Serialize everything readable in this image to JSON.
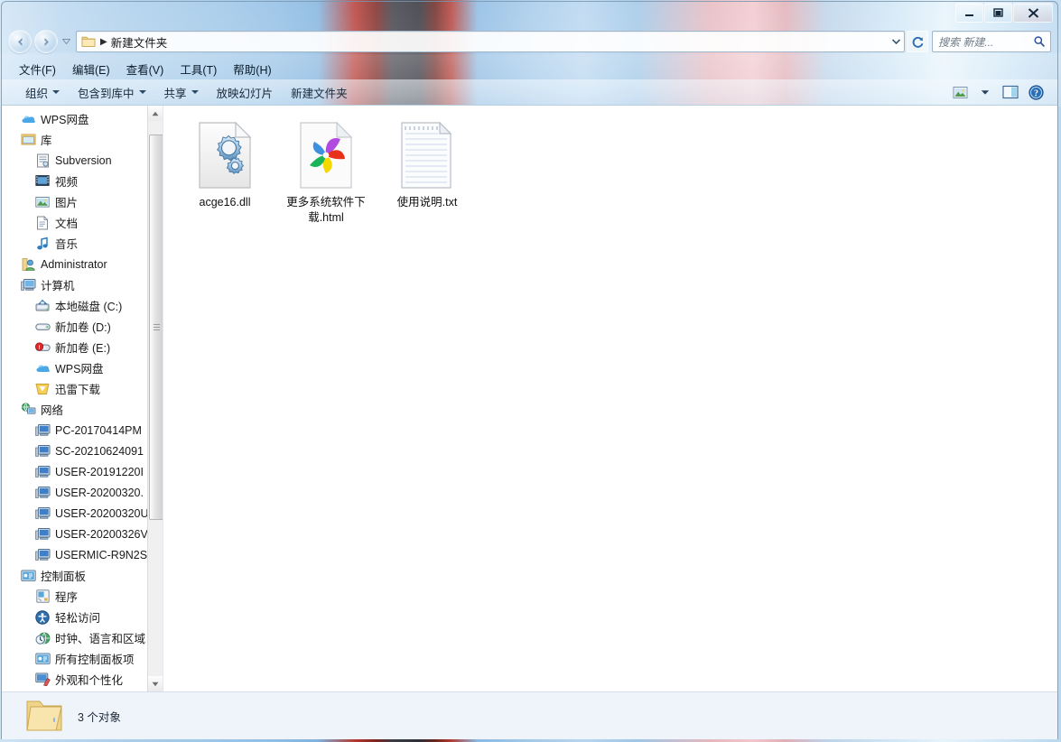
{
  "window": {
    "controls": {
      "minimize_label": "最小化",
      "maximize_label": "最大化",
      "close_label": "关闭"
    }
  },
  "address_bar": {
    "folder_icon": "folder-icon",
    "separator": "▶",
    "path": "新建文件夹",
    "dropdown_icon": "chevron-down-icon",
    "refresh_icon": "refresh-icon"
  },
  "search": {
    "placeholder": "搜索 新建...",
    "icon": "search-icon"
  },
  "menu": {
    "items": [
      {
        "label": "文件(F)"
      },
      {
        "label": "编辑(E)"
      },
      {
        "label": "查看(V)"
      },
      {
        "label": "工具(T)"
      },
      {
        "label": "帮助(H)"
      }
    ]
  },
  "toolbar": {
    "items": [
      {
        "label": "组织",
        "has_caret": true
      },
      {
        "label": "包含到库中",
        "has_caret": true
      },
      {
        "label": "共享",
        "has_caret": true
      },
      {
        "label": "放映幻灯片",
        "has_caret": false
      },
      {
        "label": "新建文件夹",
        "has_caret": false
      }
    ],
    "right_icons": [
      {
        "name": "change-view-icon"
      },
      {
        "name": "view-caret-icon"
      },
      {
        "name": "preview-pane-icon"
      },
      {
        "name": "help-icon"
      }
    ]
  },
  "navigation_pane": {
    "items": [
      {
        "label": "WPS网盘",
        "icon": "cloud-icon",
        "indent": 0
      },
      {
        "label": "库",
        "icon": "library-icon",
        "indent": 0
      },
      {
        "label": "Subversion",
        "icon": "subversion-icon",
        "indent": 1
      },
      {
        "label": "视频",
        "icon": "video-icon",
        "indent": 1
      },
      {
        "label": "图片",
        "icon": "pictures-icon",
        "indent": 1
      },
      {
        "label": "文档",
        "icon": "documents-icon",
        "indent": 1
      },
      {
        "label": "音乐",
        "icon": "music-icon",
        "indent": 1
      },
      {
        "label": "Administrator",
        "icon": "user-icon",
        "indent": 0
      },
      {
        "label": "计算机",
        "icon": "computer-icon",
        "indent": 0
      },
      {
        "label": "本地磁盘 (C:)",
        "icon": "system-drive-icon",
        "indent": 1
      },
      {
        "label": "新加卷 (D:)",
        "icon": "drive-icon",
        "indent": 1
      },
      {
        "label": "新加卷 (E:)",
        "icon": "drive-full-icon",
        "indent": 1
      },
      {
        "label": "WPS网盘",
        "icon": "cloud-icon",
        "indent": 1
      },
      {
        "label": "迅雷下载",
        "icon": "thunder-icon",
        "indent": 1
      },
      {
        "label": "网络",
        "icon": "network-icon",
        "indent": 0
      },
      {
        "label": "PC-20170414PM",
        "icon": "pc-icon",
        "indent": 1
      },
      {
        "label": "SC-20210624091",
        "icon": "pc-icon",
        "indent": 1
      },
      {
        "label": "USER-20191220I",
        "icon": "pc-icon",
        "indent": 1
      },
      {
        "label": "USER-20200320.",
        "icon": "pc-icon",
        "indent": 1
      },
      {
        "label": "USER-20200320U",
        "icon": "pc-icon",
        "indent": 1
      },
      {
        "label": "USER-20200326V",
        "icon": "pc-icon",
        "indent": 1
      },
      {
        "label": "USERMIC-R9N2S",
        "icon": "pc-icon",
        "indent": 1
      },
      {
        "label": "控制面板",
        "icon": "control-panel-icon",
        "indent": 0
      },
      {
        "label": "程序",
        "icon": "programs-icon",
        "indent": 1
      },
      {
        "label": "轻松访问",
        "icon": "ease-access-icon",
        "indent": 1
      },
      {
        "label": "时钟、语言和区域",
        "icon": "clock-region-icon",
        "indent": 1
      },
      {
        "label": "所有控制面板项",
        "icon": "control-panel-icon",
        "indent": 1
      },
      {
        "label": "外观和个性化",
        "icon": "appearance-icon",
        "indent": 1
      }
    ]
  },
  "files": [
    {
      "name": "acge16.dll",
      "icon": "dll-gears-icon"
    },
    {
      "name": "更多系统软件下载.html",
      "icon": "html-pinwheel-icon"
    },
    {
      "name": "使用说明.txt",
      "icon": "text-document-icon"
    }
  ],
  "status_bar": {
    "icon": "folder-icon",
    "text": "3 个对象"
  },
  "colors": {
    "accent": "#2b6ca3",
    "selection": "#cce8ff",
    "window_bg": "#ffffff",
    "status_bg": "#eff3fa"
  }
}
